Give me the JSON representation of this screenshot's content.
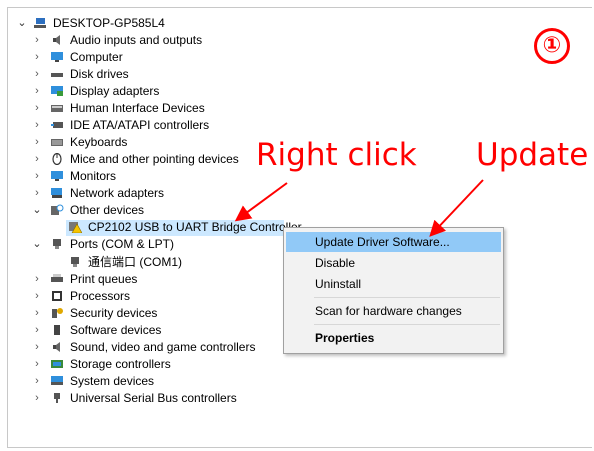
{
  "tree": {
    "root": "DESKTOP-GP585L4",
    "items": [
      {
        "label": "Audio inputs and outputs",
        "icon": "speaker-icon"
      },
      {
        "label": "Computer",
        "icon": "monitor-icon"
      },
      {
        "label": "Disk drives",
        "icon": "disk-drive-icon"
      },
      {
        "label": "Display adapters",
        "icon": "display-adapter-icon"
      },
      {
        "label": "Human Interface Devices",
        "icon": "keyboard-hid-icon"
      },
      {
        "label": "IDE ATA/ATAPI controllers",
        "icon": "ide-controller-icon"
      },
      {
        "label": "Keyboards",
        "icon": "keyboard-icon"
      },
      {
        "label": "Mice and other pointing devices",
        "icon": "mouse-icon"
      },
      {
        "label": "Monitors",
        "icon": "monitor-icon"
      },
      {
        "label": "Network adapters",
        "icon": "network-adapter-icon"
      },
      {
        "label": "Other devices",
        "icon": "unknown-device-icon"
      },
      {
        "label": "CP2102 USB to UART Bridge Controller",
        "icon": "warning-device-icon"
      },
      {
        "label": "Ports (COM & LPT)",
        "icon": "port-icon"
      },
      {
        "label": "通信端口 (COM1)",
        "icon": "port-icon"
      },
      {
        "label": "Print queues",
        "icon": "printer-icon"
      },
      {
        "label": "Processors",
        "icon": "processor-icon"
      },
      {
        "label": "Security devices",
        "icon": "security-key-icon"
      },
      {
        "label": "Software devices",
        "icon": "software-device-icon"
      },
      {
        "label": "Sound, video and game controllers",
        "icon": "speaker-icon"
      },
      {
        "label": "Storage controllers",
        "icon": "storage-controller-icon"
      },
      {
        "label": "System devices",
        "icon": "system-device-icon"
      },
      {
        "label": "Universal Serial Bus controllers",
        "icon": "usb-icon"
      }
    ]
  },
  "context_menu": {
    "items": [
      "Update Driver Software...",
      "Disable",
      "Uninstall",
      "Scan for hardware changes",
      "Properties"
    ]
  },
  "annotations": {
    "step_number": "①",
    "right_click": "Right click",
    "update": "Update"
  },
  "colors": {
    "selection": "#cce8ff",
    "menu_highlight": "#91c9f7",
    "annotation": "#ff0000"
  }
}
